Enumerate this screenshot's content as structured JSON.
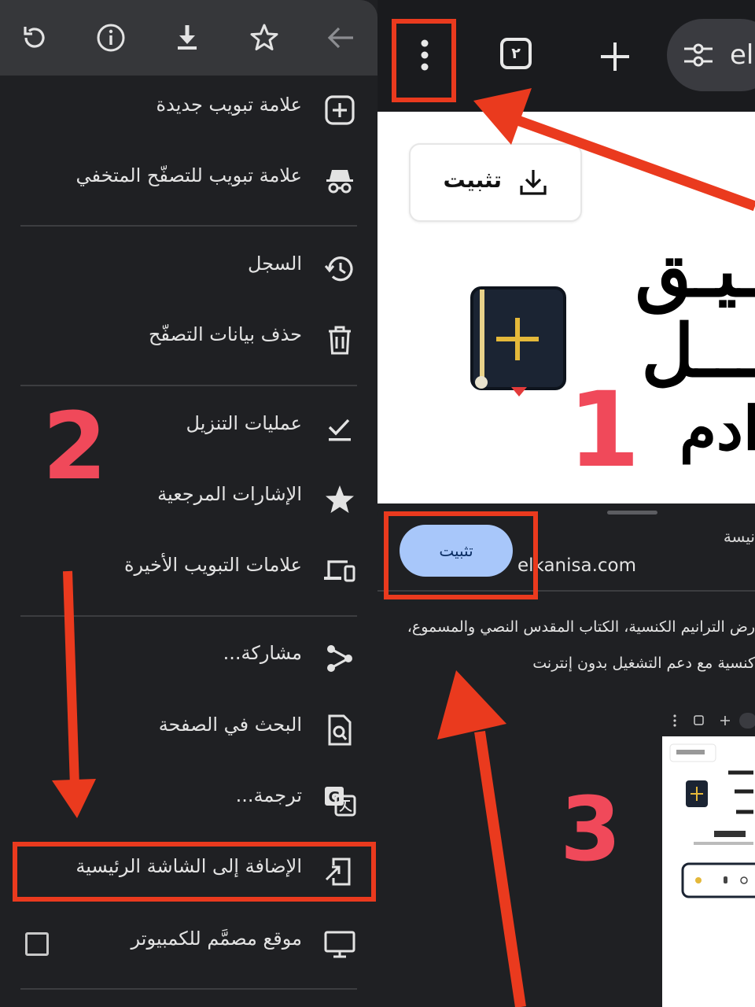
{
  "menu": {
    "items": [
      {
        "label": "علامة تبويب جديدة",
        "icon": "new-tab-icon"
      },
      {
        "label": "علامة تبويب للتصفّح المتخفي",
        "icon": "incognito-icon"
      },
      {
        "label": "السجل",
        "icon": "history-icon"
      },
      {
        "label": "حذف بيانات التصفّح",
        "icon": "trash-icon"
      },
      {
        "label": "عمليات التنزيل",
        "icon": "downloads-icon"
      },
      {
        "label": "الإشارات المرجعية",
        "icon": "star-filled-icon"
      },
      {
        "label": "علامات التبويب الأخيرة",
        "icon": "recent-tabs-icon"
      },
      {
        "label": "مشاركة...",
        "icon": "share-icon"
      },
      {
        "label": "البحث في الصفحة",
        "icon": "find-in-page-icon"
      },
      {
        "label": "ترجمة...",
        "icon": "translate-icon"
      },
      {
        "label": "الإضافة إلى الشاشة الرئيسية",
        "icon": "add-to-home-icon"
      },
      {
        "label": "موقع مصمَّم للكمبيوتر",
        "icon": "desktop-icon"
      }
    ],
    "toolbar_icons": [
      "reload-icon",
      "info-icon",
      "download-icon",
      "star-outline-icon",
      "back-arrow-icon"
    ],
    "desktop_site_checked": false
  },
  "browser": {
    "tab_count": "٢",
    "url_text": "el",
    "install_button_label": "تثبيت",
    "hero_lines": [
      "ـيـق",
      "ـــل",
      "ادم"
    ]
  },
  "sheet": {
    "title": "نيسة",
    "install_button_label": "تثبيت",
    "domain": "elkanisa.com",
    "description_lines": [
      "رض الترانيم الكنسية، الكتاب المقدس النصي والمسموع،",
      "كنسية مع دعم التشغيل بدون إنترنت"
    ]
  },
  "annotations": {
    "step1": "1",
    "step2": "2",
    "step3": "3",
    "arrow_color": "#ea3a1e",
    "number_color": "#f0495a"
  }
}
